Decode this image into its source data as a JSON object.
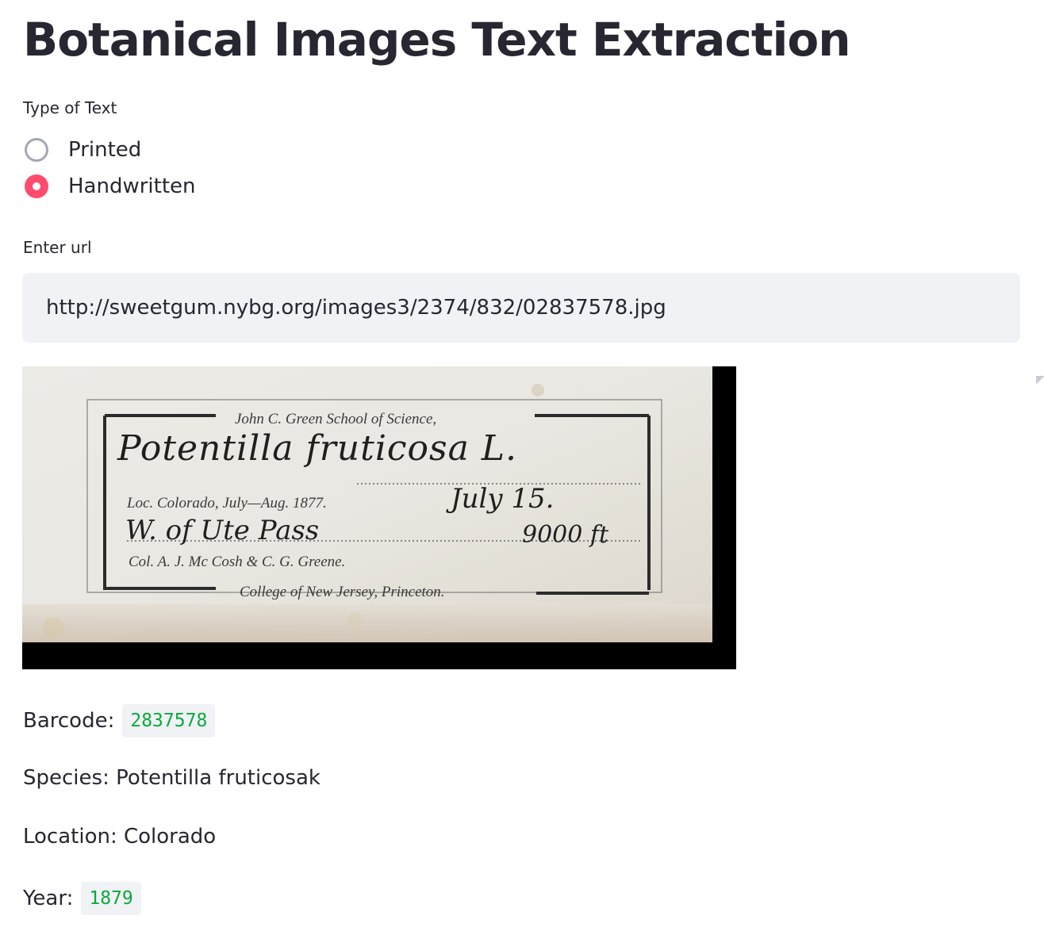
{
  "page": {
    "title": "Botanical Images Text Extraction"
  },
  "text_type": {
    "label": "Type of Text",
    "options": [
      {
        "label": "Printed",
        "selected": false
      },
      {
        "label": "Handwritten",
        "selected": true
      }
    ]
  },
  "url_input": {
    "label": "Enter url",
    "value": "http://sweetgum.nybg.org/images3/2374/832/02837578.jpg"
  },
  "specimen_label": {
    "header": "John C. Green School of Science,",
    "species_handwritten": "Potentilla fruticosa L.",
    "loc_printed": "Loc.   Colorado, July—Aug. 1877.",
    "date_handwritten": "July 15.",
    "place_handwritten": "W. of Ute Pass",
    "elevation_handwritten": "9000 ft",
    "col_printed": "Col.   A. J. Mc Cosh & C. G. Greene.",
    "footer": "College of New Jersey, Princeton."
  },
  "results": {
    "barcode_label": "Barcode:",
    "barcode_value": "2837578",
    "species_text": "Species: Potentilla fruticosak",
    "location_text": "Location: Colorado",
    "year_label": "Year:",
    "year_value": "1879"
  },
  "colors": {
    "accent": "#ff4b6e",
    "input_background": "#f0f2f6",
    "code_text": "#09ab3b",
    "text": "#262730"
  }
}
